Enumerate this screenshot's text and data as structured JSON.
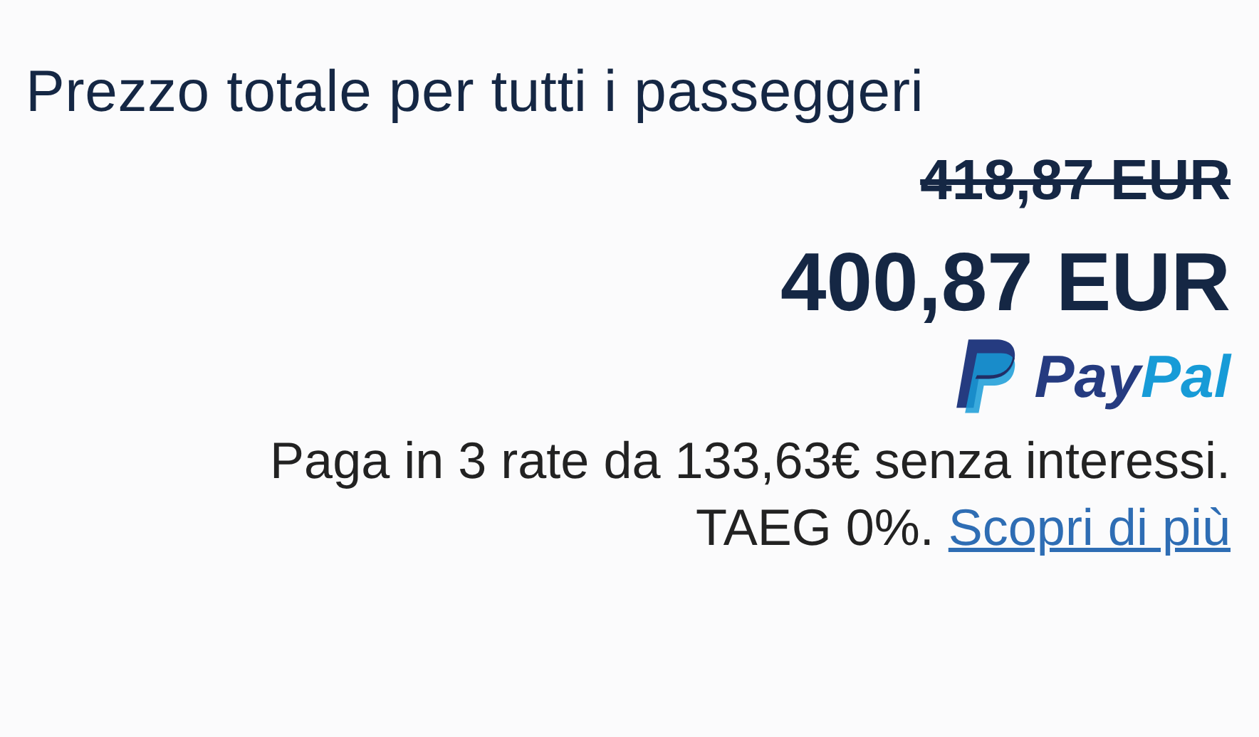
{
  "title": "Prezzo totale per tutti i passeggeri",
  "old_price": "418,87 EUR",
  "price": "400,87 EUR",
  "paypal": {
    "wordmark": [
      "Pay",
      "Pal"
    ]
  },
  "installments": {
    "text": "Paga in 3 rate da 133,63€ senza interessi. TAEG 0%.",
    "link": "Scopri di più"
  }
}
